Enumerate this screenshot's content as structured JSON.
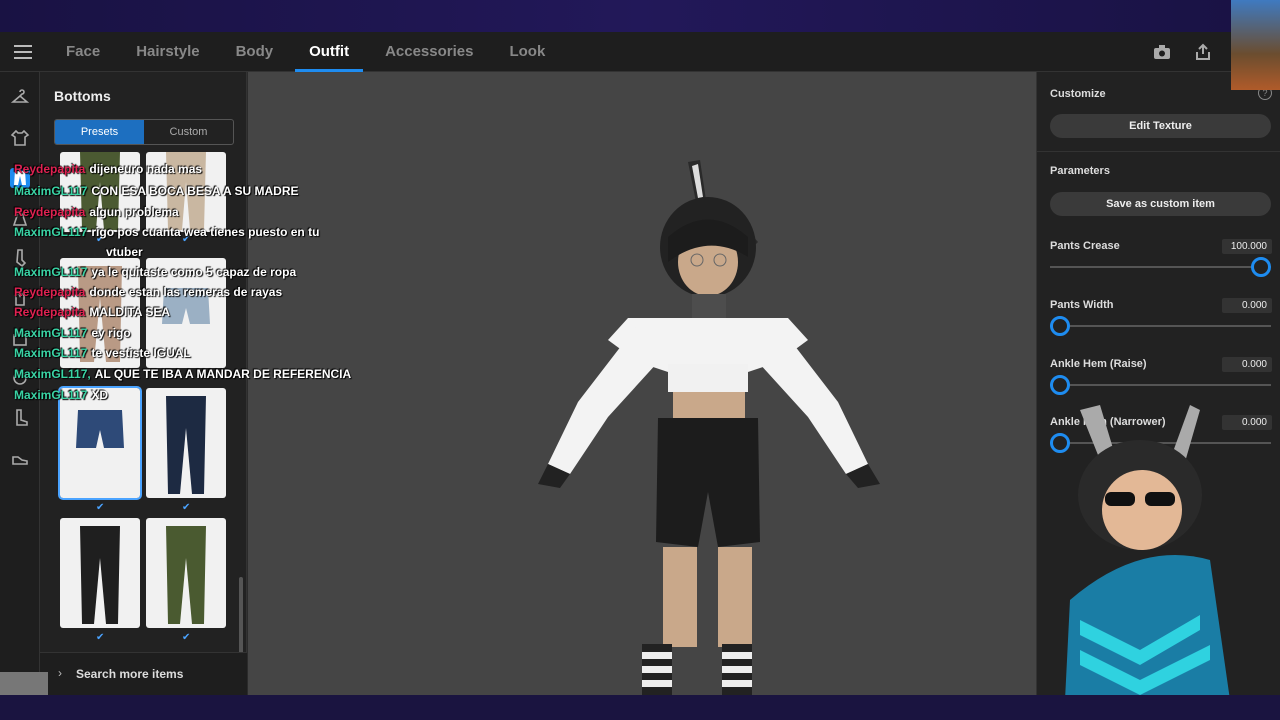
{
  "tabs": [
    "Face",
    "Hairstyle",
    "Body",
    "Outfit",
    "Accessories",
    "Look"
  ],
  "active_tab": "Outfit",
  "panel": {
    "title": "Bottoms",
    "segments": [
      "Presets",
      "Custom"
    ],
    "search_more": "Search more items"
  },
  "right": {
    "customize_title": "Customize",
    "edit_texture": "Edit Texture",
    "parameters_title": "Parameters",
    "save_custom": "Save as custom item",
    "params": [
      {
        "label": "Pants Crease",
        "value": "100.000",
        "level": 1.0
      },
      {
        "label": "Pants Width",
        "value": "0.000",
        "level": 0.0
      },
      {
        "label": "Ankle Hem (Raise)",
        "value": "0.000",
        "level": 0.0
      },
      {
        "label": "Ankle Hem (Narrower)",
        "value": "0.000",
        "level": 0.0
      }
    ]
  },
  "chat": [
    {
      "user": "Reydepapita",
      "msg": "dijeneuro nada mas"
    },
    {
      "user": "MaximGL117",
      "msg": "CON ESA BOCA BESA A SU MADRE"
    },
    {
      "user": "Reydepapita",
      "msg": "algun problema"
    },
    {
      "user": "MaximGL117",
      "msg": "rigo pos cuanta wea tienes puesto en tu"
    },
    {
      "user": "",
      "msg": "vtuber"
    },
    {
      "user": "MaximGL117",
      "msg": "ya le quitaste como 5 capaz de ropa"
    },
    {
      "user": "Reydepapita",
      "msg": "donde estan las remeras de rayas"
    },
    {
      "user": "Reydepapita",
      "msg": "MALDITA SEA"
    },
    {
      "user": "MaximGL117",
      "msg": "ey rigo"
    },
    {
      "user": "MaximGL117",
      "msg": "te vestiste IGUAL"
    },
    {
      "user": "MaximGL117,",
      "msg": "AL QUE TE IBA A MANDAR DE REFERENCIA"
    },
    {
      "user": "MaximGL117",
      "msg": "XD"
    }
  ],
  "colors": {
    "accent": "#1e8cf0",
    "chat_green": "#3ad4a5",
    "chat_red": "#e02252"
  }
}
